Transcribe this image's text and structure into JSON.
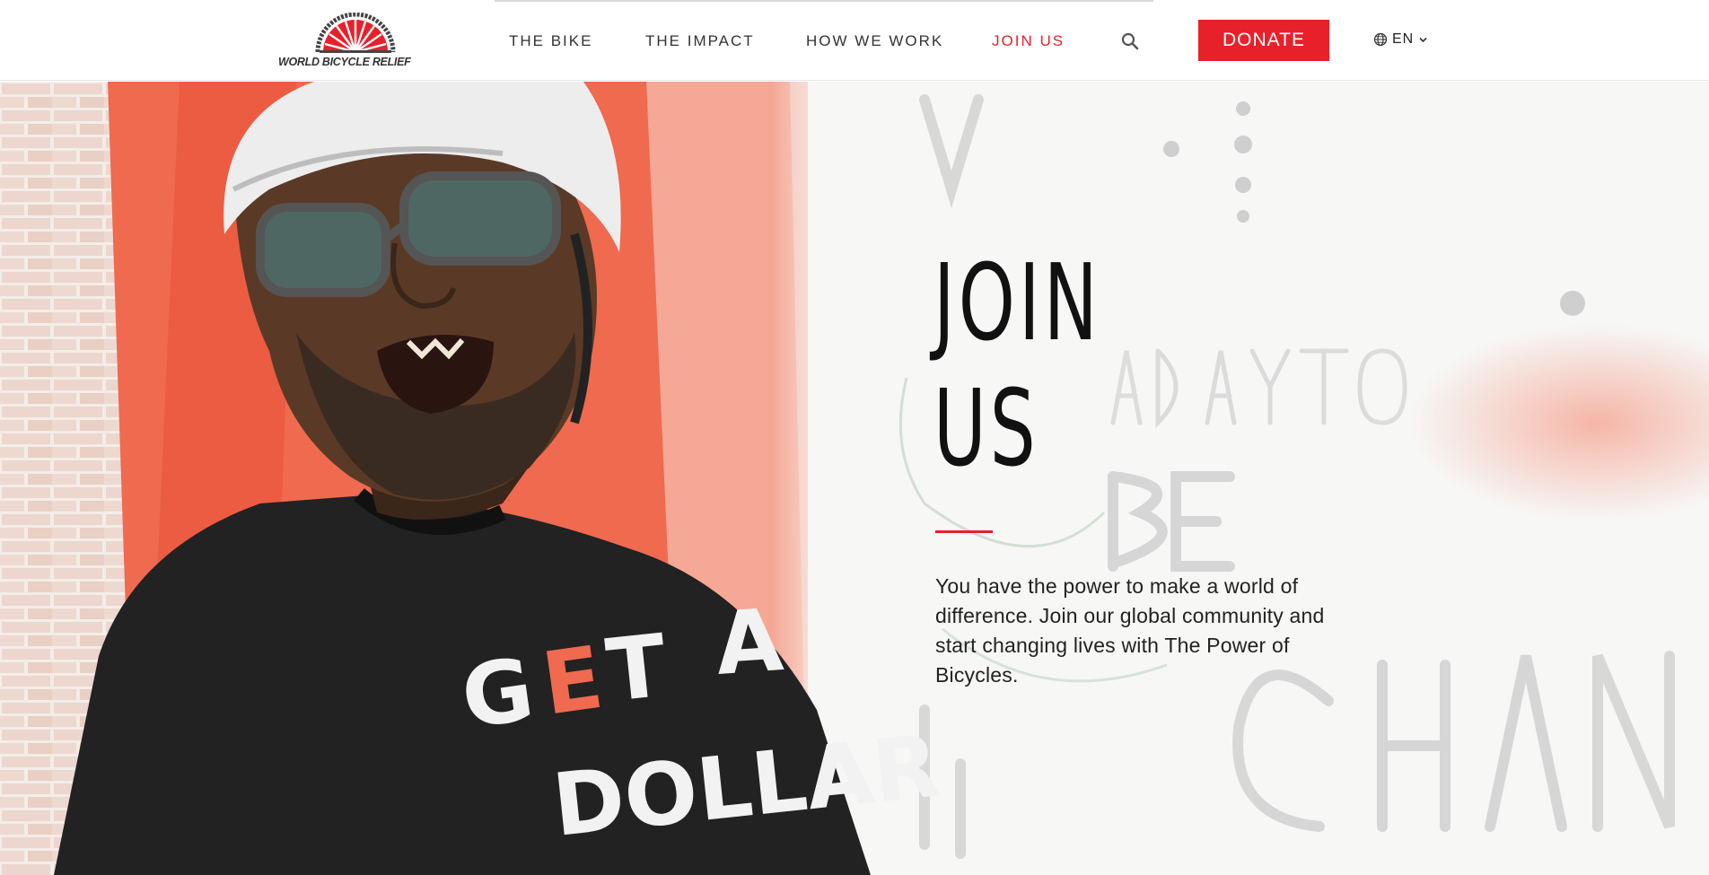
{
  "brand": {
    "name": "WORLD BICYCLE RELIEF",
    "accent_color": "#e8202a",
    "logo_icon": "umbrella-wheel-icon"
  },
  "nav": {
    "items": [
      {
        "label": "THE BIKE",
        "active": false
      },
      {
        "label": "THE IMPACT",
        "active": false
      },
      {
        "label": "HOW WE WORK",
        "active": false
      },
      {
        "label": "JOIN US",
        "active": true
      }
    ],
    "search_icon": "search-icon",
    "donate_label": "DONATE",
    "language": {
      "label": "EN",
      "icon": "globe-icon",
      "chevron": "chevron-down-icon"
    }
  },
  "hero": {
    "title_lines": [
      "JOIN",
      "US"
    ],
    "body": "You have the power to make a world of difference. Join our global community and start changing lives with The Power of Bicycles.",
    "image_alt": "Smiling man wearing a bicycle helmet and glasses in a black t-shirt, standing before a painted brick wall",
    "shirt_text": "GET A DOLLAR",
    "wall_text": [
      "A DAY TO",
      "BE",
      "CHANGE"
    ]
  }
}
